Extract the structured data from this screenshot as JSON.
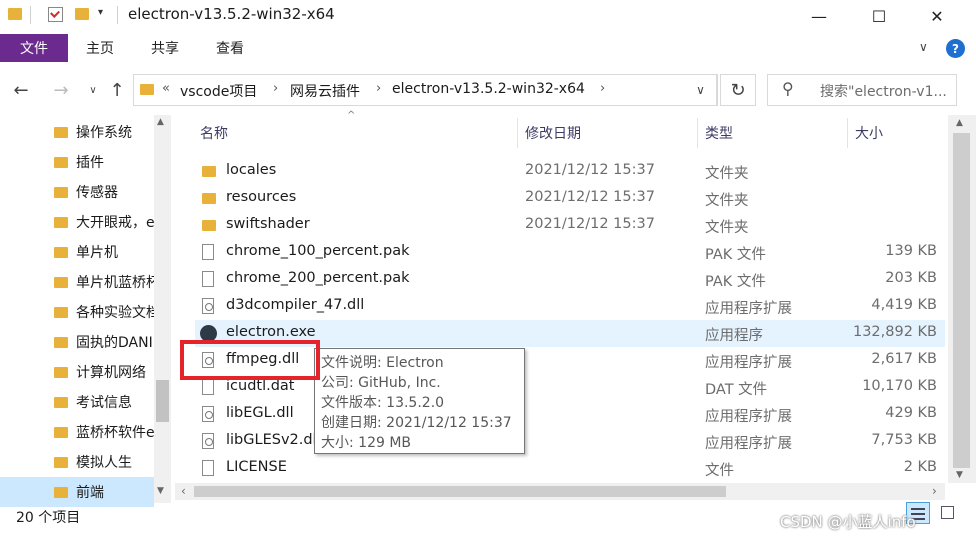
{
  "window": {
    "title": "electron-v13.5.2-win32-x64",
    "minimize_glyph": "—",
    "maximize_glyph": "☐",
    "close_glyph": "✕"
  },
  "ribbon": {
    "tabs": [
      "文件",
      "主页",
      "共享",
      "查看"
    ],
    "help_glyph": "?"
  },
  "address": {
    "overflow": "«",
    "crumbs": [
      "vscode项目",
      "网易云插件",
      "electron-v13.5.2-win32-x64"
    ],
    "search_placeholder": "搜索\"electron-v1..."
  },
  "nav_pane": {
    "items": [
      "操作系统",
      "插件",
      "传感器",
      "大开眼戒，e",
      "单片机",
      "单片机蓝桥杯",
      "各种实验文档",
      "固执的DANI",
      "计算机网络",
      "考试信息",
      "蓝桥杯软件e",
      "模拟人生",
      "前端"
    ]
  },
  "columns": {
    "name": "名称",
    "date": "修改日期",
    "type": "类型",
    "size": "大小"
  },
  "files": [
    {
      "icon": "folder-icon",
      "name": "locales",
      "date": "2021/12/12 15:37",
      "type": "文件夹",
      "size": ""
    },
    {
      "icon": "folder-icon",
      "name": "resources",
      "date": "2021/12/12 15:37",
      "type": "文件夹",
      "size": ""
    },
    {
      "icon": "folder-icon",
      "name": "swiftshader",
      "date": "2021/12/12 15:37",
      "type": "文件夹",
      "size": ""
    },
    {
      "icon": "file-icon",
      "name": "chrome_100_percent.pak",
      "date": "",
      "type": "PAK 文件",
      "size": "139 KB"
    },
    {
      "icon": "file-icon",
      "name": "chrome_200_percent.pak",
      "date": "",
      "type": "PAK 文件",
      "size": "203 KB"
    },
    {
      "icon": "dll-icon",
      "name": "d3dcompiler_47.dll",
      "date": "",
      "type": "应用程序扩展",
      "size": "4,419 KB"
    },
    {
      "icon": "electron-app-icon",
      "name": "electron.exe",
      "date": "",
      "type": "应用程序",
      "size": "132,892 KB"
    },
    {
      "icon": "dll-icon",
      "name": "ffmpeg.dll",
      "date": "",
      "type": "应用程序扩展",
      "size": "2,617 KB"
    },
    {
      "icon": "file-icon",
      "name": "icudtl.dat",
      "date": "",
      "type": "DAT 文件",
      "size": "10,170 KB"
    },
    {
      "icon": "dll-icon",
      "name": "libEGL.dll",
      "date": "",
      "type": "应用程序扩展",
      "size": "429 KB"
    },
    {
      "icon": "dll-icon",
      "name": "libGLESv2.dll",
      "date": "",
      "type": "应用程序扩展",
      "size": "7,753 KB"
    },
    {
      "icon": "file-icon",
      "name": "LICENSE",
      "date": "",
      "type": "文件",
      "size": "2 KB"
    }
  ],
  "tooltip": {
    "lines": [
      "文件说明: Electron",
      "公司: GitHub, Inc.",
      "文件版本: 13.5.2.0",
      "创建日期: 2021/12/12 15:37",
      "大小: 129 MB"
    ]
  },
  "status": {
    "count": "20 个项目"
  },
  "watermark": "CSDN @小蓝人info",
  "colors": {
    "file_tab": "#6b2b8e",
    "selection": "#e5f3ff",
    "highlight_box": "#e4232b",
    "folder": "#e8b23a"
  }
}
